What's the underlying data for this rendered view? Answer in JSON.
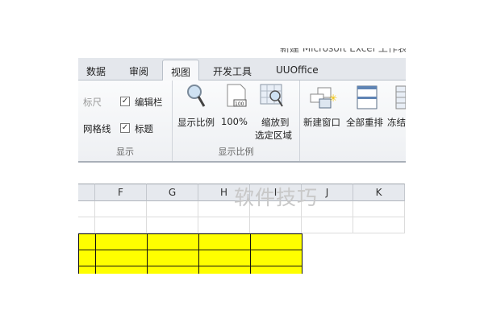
{
  "window_title": "新建 Microsoft Excel 工作表",
  "tabs": [
    "数据",
    "审阅",
    "视图",
    "开发工具",
    "UUOffice"
  ],
  "active_tab": "视图",
  "ribbon": {
    "show_group": {
      "label": "显示",
      "ruler": "标尺",
      "formula_bar": "编辑栏",
      "gridlines": "网格线",
      "headings": "标题",
      "formula_bar_checked": true,
      "headings_checked": true
    },
    "zoom_group": {
      "label": "显示比例",
      "zoom": "显示比例",
      "zoom100": "100%",
      "zoom_sel_1": "缩放到",
      "zoom_sel_2": "选定区域"
    },
    "window_group": {
      "new_window": "新建窗口",
      "arrange_all": "全部重排",
      "freeze": "冻结"
    }
  },
  "columns": [
    "F",
    "G",
    "H",
    "I",
    "J",
    "K"
  ],
  "highlight_color": "#ffff00",
  "watermark": "软件技巧"
}
